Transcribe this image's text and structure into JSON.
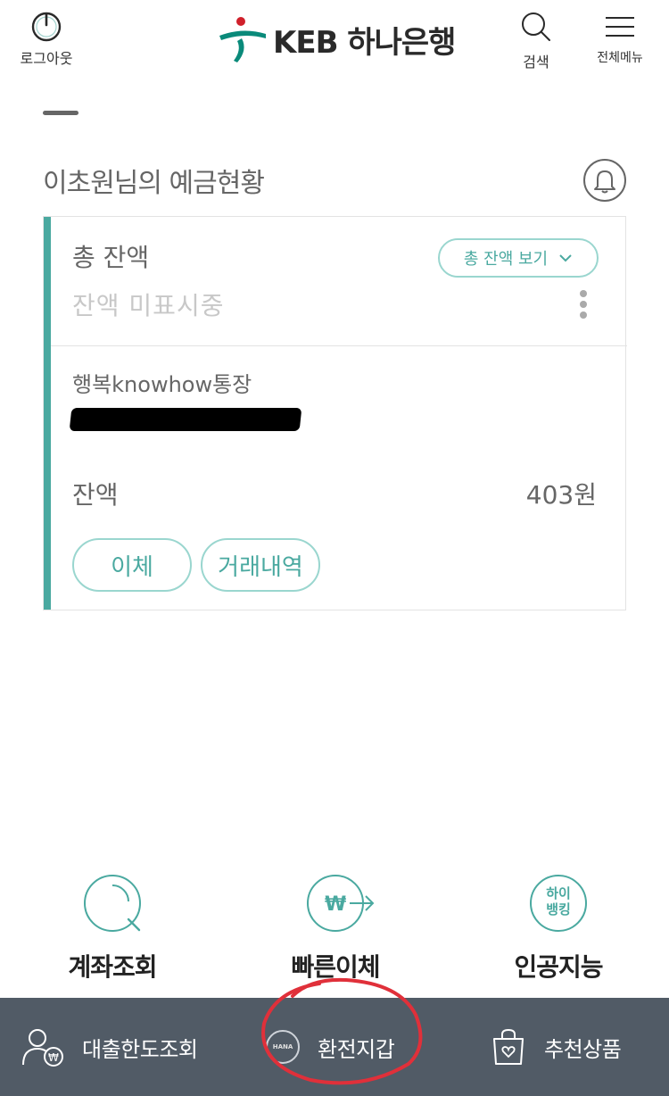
{
  "header": {
    "logout_label": "로그아웃",
    "logo_text": "KEB 하나은행",
    "search_label": "검색",
    "menu_label": "전체메뉴"
  },
  "deposit": {
    "title": "이초원님의 예금현황",
    "total_label": "총 잔액",
    "total_status": "잔액 미표시중",
    "view_button": "총 잔액 보기",
    "account_name": "행복knowhow통장",
    "balance_label": "잔액",
    "balance_value": "403원",
    "transfer_button": "이체",
    "history_button": "거래내역"
  },
  "quick_menu": {
    "account_inquiry": "계좌조회",
    "fast_transfer": "빠른이체",
    "ai": "인공지능",
    "hi_banking_badge_line1": "하이",
    "hi_banking_badge_line2": "뱅킹"
  },
  "bottom_bar": {
    "loan_limit": "대출한도조회",
    "fx_wallet": "환전지갑",
    "fx_wallet_coin": "HANA",
    "recommend": "추천상품"
  },
  "colors": {
    "accent": "#4aa9a0",
    "bottom_bar": "#515b66",
    "annotation": "#e0303a"
  }
}
